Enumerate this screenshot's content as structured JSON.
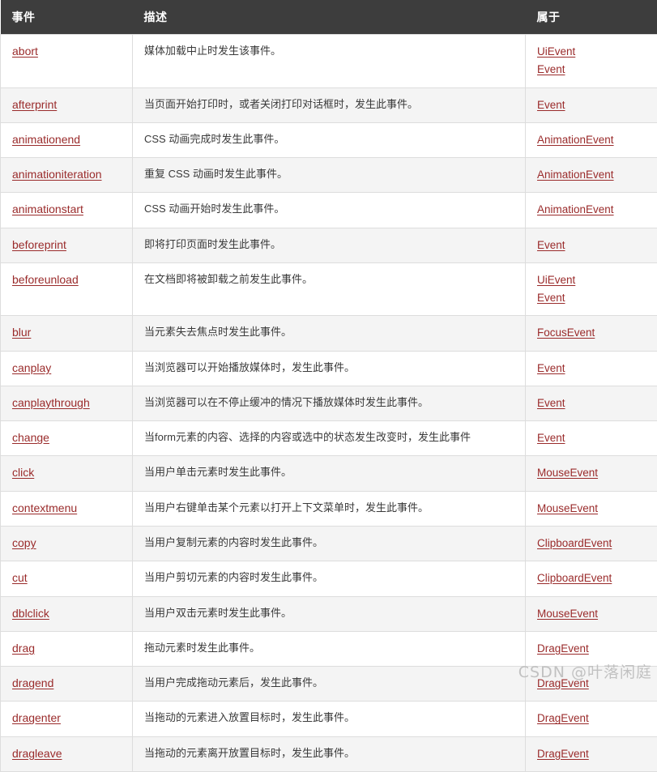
{
  "table": {
    "headers": {
      "event": "事件",
      "description": "描述",
      "belongs_to": "属于"
    },
    "rows": [
      {
        "event": "abort",
        "description": "媒体加载中止时发生该事件。",
        "belongs_to": [
          "UiEvent",
          "Event"
        ]
      },
      {
        "event": "afterprint",
        "description": "当页面开始打印时，或者关闭打印对话框时，发生此事件。",
        "belongs_to": [
          "Event"
        ]
      },
      {
        "event": "animationend",
        "description": "CSS 动画完成时发生此事件。",
        "belongs_to": [
          "AnimationEvent"
        ]
      },
      {
        "event": "animationiteration",
        "description": "重复 CSS 动画时发生此事件。",
        "belongs_to": [
          "AnimationEvent"
        ]
      },
      {
        "event": "animationstart",
        "description": "CSS 动画开始时发生此事件。",
        "belongs_to": [
          "AnimationEvent"
        ]
      },
      {
        "event": "beforeprint",
        "description": "即将打印页面时发生此事件。",
        "belongs_to": [
          "Event"
        ]
      },
      {
        "event": "beforeunload",
        "description": "在文档即将被卸载之前发生此事件。",
        "belongs_to": [
          "UiEvent",
          "Event"
        ]
      },
      {
        "event": "blur",
        "description": "当元素失去焦点时发生此事件。",
        "belongs_to": [
          "FocusEvent"
        ]
      },
      {
        "event": "canplay",
        "description": "当浏览器可以开始播放媒体时，发生此事件。",
        "belongs_to": [
          "Event"
        ]
      },
      {
        "event": "canplaythrough",
        "description": "当浏览器可以在不停止缓冲的情况下播放媒体时发生此事件。",
        "belongs_to": [
          "Event"
        ]
      },
      {
        "event": "change",
        "description": "当form元素的内容、选择的内容或选中的状态发生改变时，发生此事件",
        "belongs_to": [
          "Event"
        ]
      },
      {
        "event": "click",
        "description": "当用户单击元素时发生此事件。",
        "belongs_to": [
          "MouseEvent"
        ]
      },
      {
        "event": "contextmenu",
        "description": "当用户右键单击某个元素以打开上下文菜单时，发生此事件。",
        "belongs_to": [
          "MouseEvent"
        ]
      },
      {
        "event": "copy",
        "description": "当用户复制元素的内容时发生此事件。",
        "belongs_to": [
          "ClipboardEvent"
        ]
      },
      {
        "event": "cut",
        "description": "当用户剪切元素的内容时发生此事件。",
        "belongs_to": [
          "ClipboardEvent"
        ]
      },
      {
        "event": "dblclick",
        "description": "当用户双击元素时发生此事件。",
        "belongs_to": [
          "MouseEvent"
        ]
      },
      {
        "event": "drag",
        "description": "拖动元素时发生此事件。",
        "belongs_to": [
          "DragEvent"
        ]
      },
      {
        "event": "dragend",
        "description": "当用户完成拖动元素后，发生此事件。",
        "belongs_to": [
          "DragEvent"
        ]
      },
      {
        "event": "dragenter",
        "description": "当拖动的元素进入放置目标时，发生此事件。",
        "belongs_to": [
          "DragEvent"
        ]
      },
      {
        "event": "dragleave",
        "description": "当拖动的元素离开放置目标时，发生此事件。",
        "belongs_to": [
          "DragEvent"
        ]
      }
    ]
  },
  "watermark": {
    "text": "CSDN @叶落闲庭"
  },
  "colors": {
    "header_background": "#3d3d3d",
    "header_text": "#ffffff",
    "link": "#9a2b2b",
    "row_alt_background": "#f4f4f4",
    "row_background": "#ffffff",
    "border": "#dddddd",
    "body_text": "#333333"
  }
}
